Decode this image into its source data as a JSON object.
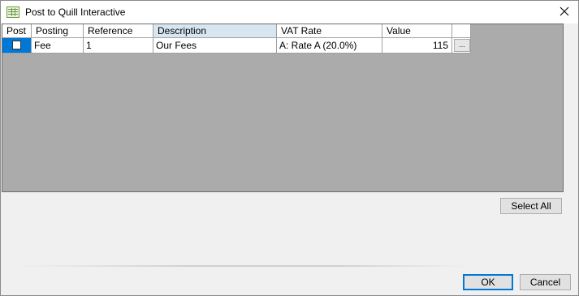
{
  "window": {
    "title": "Post to Quill Interactive",
    "app_icon": "grid-app-icon",
    "close_icon": "close-icon"
  },
  "grid": {
    "columns": [
      "Post",
      "Posting",
      "Reference",
      "Description",
      "VAT Rate",
      "Value"
    ],
    "selected_column": "Description",
    "rows": [
      {
        "post_checked": false,
        "posting": "Fee",
        "reference": "1",
        "description": "Our Fees",
        "vat_rate": "A: Rate A (20.0%)",
        "value": "115",
        "ellipsis": "..."
      }
    ]
  },
  "buttons": {
    "select_all": "Select All",
    "ok": "OK",
    "cancel": "Cancel"
  },
  "colors": {
    "selection_blue": "#0078d7",
    "grid_background": "#ababab",
    "selected_header": "#d8e6f2"
  }
}
